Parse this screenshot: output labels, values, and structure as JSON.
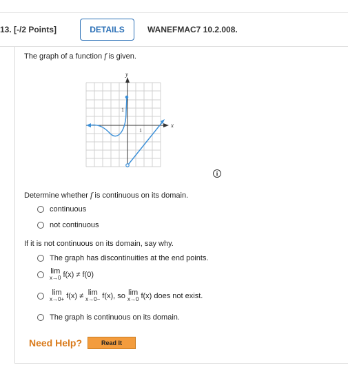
{
  "header": {
    "question_number": "13. [-/2 Points]",
    "details_label": "DETAILS",
    "question_code": "WANEFMAC7 10.2.008."
  },
  "prompt": "The graph of a function",
  "prompt_var": "f",
  "prompt_end": "is given.",
  "graph": {
    "y_label": "y",
    "x_label": "x",
    "tick_1_y": "1",
    "tick_1_x": "1"
  },
  "question1": {
    "pre": "Determine whether",
    "var": "f",
    "post": "is continuous on its domain.",
    "options": [
      "continuous",
      "not continuous"
    ]
  },
  "question2": {
    "text": "If it is not continuous on its domain, say why.",
    "opt1": "The graph has discontinuities at the end points.",
    "opt2_lim": "lim",
    "opt2_sub": "x→0",
    "opt2_expr": "f(x) ≠ f(0)",
    "opt3_lim1": "lim",
    "opt3_sub1": "x→0+",
    "opt3_expr1": "f(x) ≠",
    "opt3_lim2": "lim",
    "opt3_sub2": "x→0−",
    "opt3_expr2": "f(x), so",
    "opt3_lim3": "lim",
    "opt3_sub3": "x→0",
    "opt3_expr3": "f(x) does not exist.",
    "opt4": "The graph is continuous on its domain."
  },
  "footer": {
    "need_help": "Need Help?",
    "read_it": "Read It"
  },
  "colors": {
    "accent": "#2a6fb6",
    "curve": "#3a8fd8",
    "help": "#d97a1a",
    "button": "#f39c3d"
  }
}
